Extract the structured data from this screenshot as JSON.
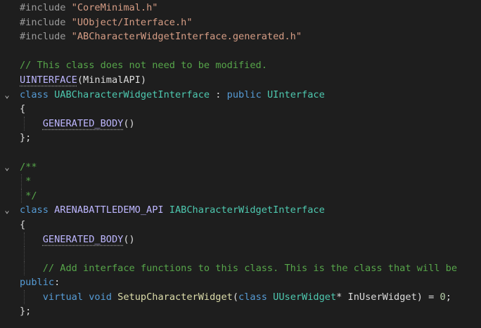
{
  "editor": {
    "lines": [
      {
        "fold": "",
        "guides": [],
        "tokens": [
          {
            "t": "#include ",
            "c": "pp"
          },
          {
            "t": "\"CoreMinimal.h\"",
            "c": "str"
          }
        ]
      },
      {
        "fold": "",
        "guides": [],
        "tokens": [
          {
            "t": "#include ",
            "c": "pp"
          },
          {
            "t": "\"UObject/Interface.h\"",
            "c": "str"
          }
        ]
      },
      {
        "fold": "",
        "guides": [],
        "tokens": [
          {
            "t": "#include ",
            "c": "pp"
          },
          {
            "t": "\"ABCharacterWidgetInterface.generated.h\"",
            "c": "str"
          }
        ]
      },
      {
        "fold": "",
        "guides": [],
        "tokens": []
      },
      {
        "fold": "",
        "guides": [],
        "tokens": [
          {
            "t": "// This class does not need to be modified.",
            "c": "cmt"
          }
        ]
      },
      {
        "fold": "",
        "guides": [],
        "tokens": [
          {
            "t": "UINTERFACE",
            "c": "mac macsq"
          },
          {
            "t": "(MinimalAPI)",
            "c": "plain"
          }
        ]
      },
      {
        "fold": "⌄",
        "guides": [],
        "tokens": [
          {
            "t": "class ",
            "c": "kw"
          },
          {
            "t": "UABCharacterWidgetInterface",
            "c": "type"
          },
          {
            "t": " : ",
            "c": "plain"
          },
          {
            "t": "public ",
            "c": "kw"
          },
          {
            "t": "UInterface",
            "c": "type"
          }
        ]
      },
      {
        "fold": "",
        "guides": [],
        "tokens": [
          {
            "t": "{",
            "c": "plain"
          }
        ]
      },
      {
        "fold": "",
        "guides": [
          34
        ],
        "tokens": [
          {
            "t": "    ",
            "c": "plain"
          },
          {
            "t": "GENERATED_BODY",
            "c": "mac macsq"
          },
          {
            "t": "()",
            "c": "plain"
          }
        ]
      },
      {
        "fold": "",
        "guides": [],
        "tokens": [
          {
            "t": "};",
            "c": "plain"
          }
        ]
      },
      {
        "fold": "",
        "guides": [],
        "tokens": []
      },
      {
        "fold": "⌄",
        "guides": [],
        "tokens": [
          {
            "t": "/**",
            "c": "cmt"
          }
        ]
      },
      {
        "fold": "",
        "guides": [
          30
        ],
        "tokens": [
          {
            "t": " *",
            "c": "cmt"
          }
        ]
      },
      {
        "fold": "",
        "guides": [
          30
        ],
        "tokens": [
          {
            "t": " */",
            "c": "cmt"
          }
        ]
      },
      {
        "fold": "⌄",
        "guides": [],
        "tokens": [
          {
            "t": "class ",
            "c": "kw"
          },
          {
            "t": "ARENABATTLEDEMO_API ",
            "c": "mac"
          },
          {
            "t": "IABCharacterWidgetInterface",
            "c": "type"
          }
        ]
      },
      {
        "fold": "",
        "guides": [],
        "tokens": [
          {
            "t": "{",
            "c": "plain"
          }
        ]
      },
      {
        "fold": "",
        "guides": [
          34
        ],
        "tokens": [
          {
            "t": "    ",
            "c": "plain"
          },
          {
            "t": "GENERATED_BODY",
            "c": "mac macsq"
          },
          {
            "t": "()",
            "c": "plain"
          }
        ]
      },
      {
        "fold": "",
        "guides": [
          34
        ],
        "tokens": []
      },
      {
        "fold": "",
        "guides": [
          34
        ],
        "tokens": [
          {
            "t": "    ",
            "c": "plain"
          },
          {
            "t": "// Add interface functions to this class. This is the class that will be",
            "c": "cmt"
          }
        ]
      },
      {
        "fold": "",
        "guides": [],
        "tokens": [
          {
            "t": "public",
            "c": "kw"
          },
          {
            "t": ":",
            "c": "plain"
          }
        ]
      },
      {
        "fold": "",
        "guides": [
          34
        ],
        "tokens": [
          {
            "t": "    ",
            "c": "plain"
          },
          {
            "t": "virtual ",
            "c": "kw"
          },
          {
            "t": "void ",
            "c": "kw"
          },
          {
            "t": "SetupCharacterWidget",
            "c": "fn"
          },
          {
            "t": "(",
            "c": "plain"
          },
          {
            "t": "class ",
            "c": "kw"
          },
          {
            "t": "UUserWidget",
            "c": "type"
          },
          {
            "t": "* InUserWidget) = ",
            "c": "plain"
          },
          {
            "t": "0",
            "c": "num"
          },
          {
            "t": ";",
            "c": "plain"
          }
        ]
      },
      {
        "fold": "",
        "guides": [],
        "tokens": [
          {
            "t": "};",
            "c": "plain"
          }
        ]
      }
    ]
  }
}
